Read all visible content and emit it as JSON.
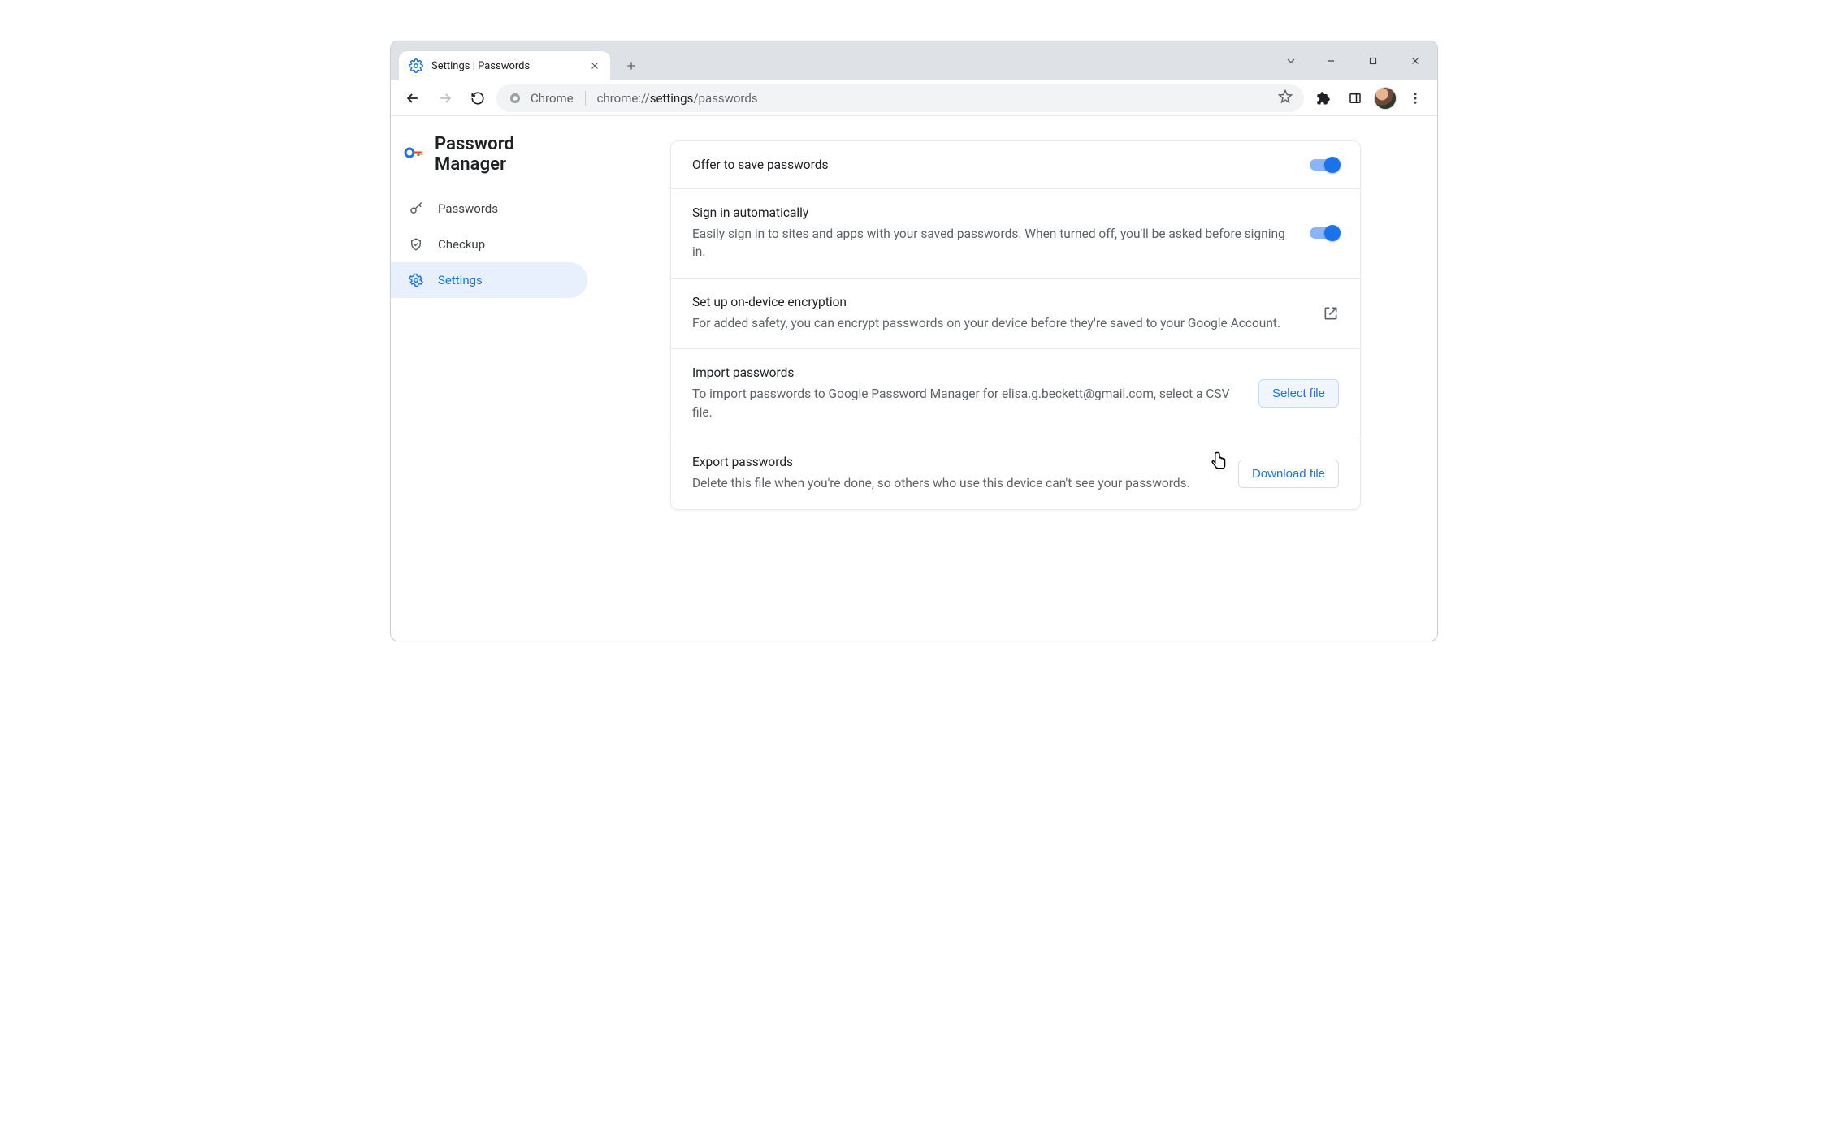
{
  "window": {
    "tab_title": "Settings | Passwords"
  },
  "toolbar": {
    "chip": "Chrome",
    "url_prefix": "chrome://",
    "url_strong": "settings",
    "url_suffix": "/passwords"
  },
  "brand": {
    "title": "Password Manager"
  },
  "nav": [
    {
      "key": "passwords",
      "label": "Passwords"
    },
    {
      "key": "checkup",
      "label": "Checkup"
    },
    {
      "key": "settings",
      "label": "Settings"
    }
  ],
  "rows": {
    "offer": {
      "title": "Offer to save passwords"
    },
    "auto": {
      "title": "Sign in automatically",
      "desc": "Easily sign in to sites and apps with your saved passwords. When turned off, you'll be asked before signing in."
    },
    "ode": {
      "title": "Set up on-device encryption",
      "desc": "For added safety, you can encrypt passwords on your device before they're saved to your Google Account."
    },
    "import": {
      "title": "Import passwords",
      "desc": "To import passwords to Google Password Manager for elisa.g.beckett@gmail.com, select a CSV file.",
      "button": "Select file"
    },
    "export": {
      "title": "Export passwords",
      "desc": "Delete this file when you're done, so others who use this device can't see your passwords.",
      "button": "Download file"
    }
  }
}
